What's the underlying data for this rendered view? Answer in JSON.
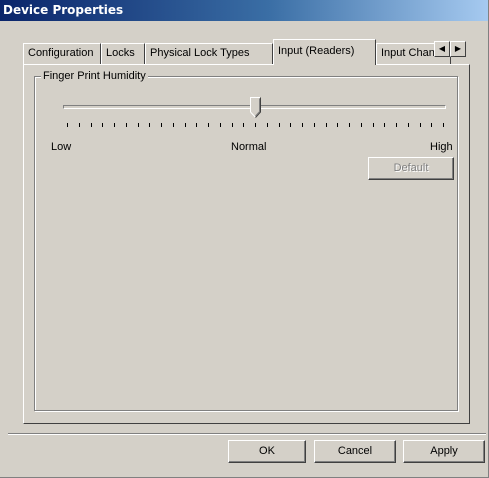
{
  "window": {
    "title": "Device Properties"
  },
  "tabs": [
    {
      "label": "Configuration",
      "active": false
    },
    {
      "label": "Locks",
      "active": false
    },
    {
      "label": "Physical Lock Types",
      "active": false
    },
    {
      "label": "Input (Readers)",
      "active": true
    },
    {
      "label": "Input Chann",
      "active": false
    }
  ],
  "tab_scroll": {
    "left_icon": "triangle-left-icon",
    "right_icon": "triangle-right-icon"
  },
  "group": {
    "title": "Finger Print Humidity",
    "slider": {
      "min_label": "Low",
      "mid_label": "Normal",
      "max_label": "High",
      "position": 0.5,
      "tick_count": 33
    },
    "default_button": {
      "label": "Default",
      "enabled": false
    }
  },
  "buttons": {
    "ok": "OK",
    "cancel": "Cancel",
    "apply": "Apply"
  }
}
